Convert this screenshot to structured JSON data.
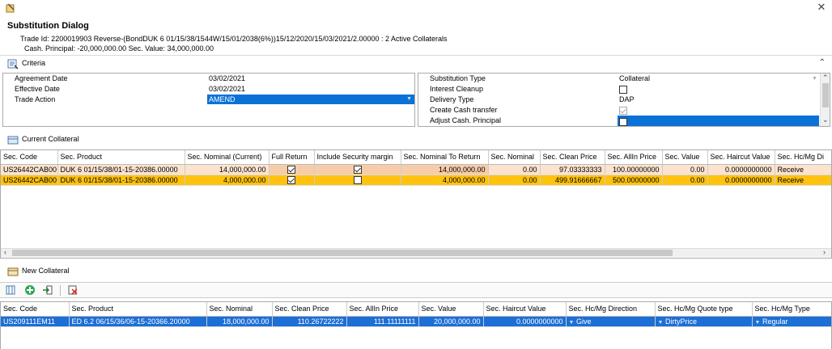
{
  "window": {
    "title": "Substitution Dialog",
    "close": "✕"
  },
  "header": {
    "trade_line": "Trade Id: 2200019903 Reverse-(BondDUK 6 01/15/38/1544W/15/01/2038(6%))15/12/2020/15/03/2021/2.00000 : 2 Active Collaterals",
    "cash_line": "Cash. Principal: -20,000,000.00  Sec. Value: 34,000,000.00"
  },
  "criteria": {
    "label": "Criteria",
    "left": [
      {
        "label": "Agreement Date",
        "value": "03/02/2021"
      },
      {
        "label": "Effective Date",
        "value": "03/02/2021"
      },
      {
        "label": "Trade Action",
        "value": "AMEND"
      }
    ],
    "right": [
      {
        "label": "Substitution Type",
        "value": "Collateral"
      },
      {
        "label": "Interest Cleanup",
        "value": ""
      },
      {
        "label": "Delivery Type",
        "value": "DAP"
      },
      {
        "label": "Create Cash transfer",
        "value": ""
      },
      {
        "label": "Adjust Cash. Principal",
        "value": ""
      }
    ]
  },
  "current_collateral": {
    "label": "Current Collateral",
    "columns": [
      "Sec. Code",
      "Sec. Product",
      "Sec. Nominal (Current)",
      "Full Return",
      "Include Security margin",
      "Sec. Nominal To Return",
      "Sec. Nominal",
      "Sec. Clean Price",
      "Sec. AllIn Price",
      "Sec. Value",
      "Sec. Haircut Value",
      "Sec. Hc/Mg Di"
    ],
    "rows": [
      [
        "US26442CAB00",
        "DUK 6 01/15/38/01-15-20386.00000",
        "14,000,000.00",
        "",
        "",
        "14,000,000.00",
        "0.00",
        "97.03333333",
        "100.00000000",
        "0.00",
        "0.0000000000",
        "Receive"
      ],
      [
        "US26442CAB00",
        "DUK 6 01/15/38/01-15-20386.00000",
        "4,000,000.00",
        "",
        "",
        "4,000,000.00",
        "0.00",
        "499.91666667",
        "500.00000000",
        "0.00",
        "0.0000000000",
        "Receive"
      ]
    ]
  },
  "new_collateral": {
    "label": "New Collateral",
    "columns": [
      "Sec. Code",
      "Sec. Product",
      "Sec. Nominal",
      "Sec. Clean Price",
      "Sec. AllIn Price",
      "Sec. Value",
      "Sec. Haircut Value",
      "Sec. Hc/Mg Direction",
      "Sec. Hc/Mg Quote type",
      "Sec. Hc/Mg Type"
    ],
    "rows": [
      [
        "US209111EM11",
        "ED 6.2 06/15/36/06-15-20366.20000",
        "18,000,000.00",
        "110.26722222",
        "111.11111111",
        "20,000,000.00",
        "0.0000000000",
        "Give",
        "DirtyPrice",
        "Regular"
      ]
    ]
  }
}
